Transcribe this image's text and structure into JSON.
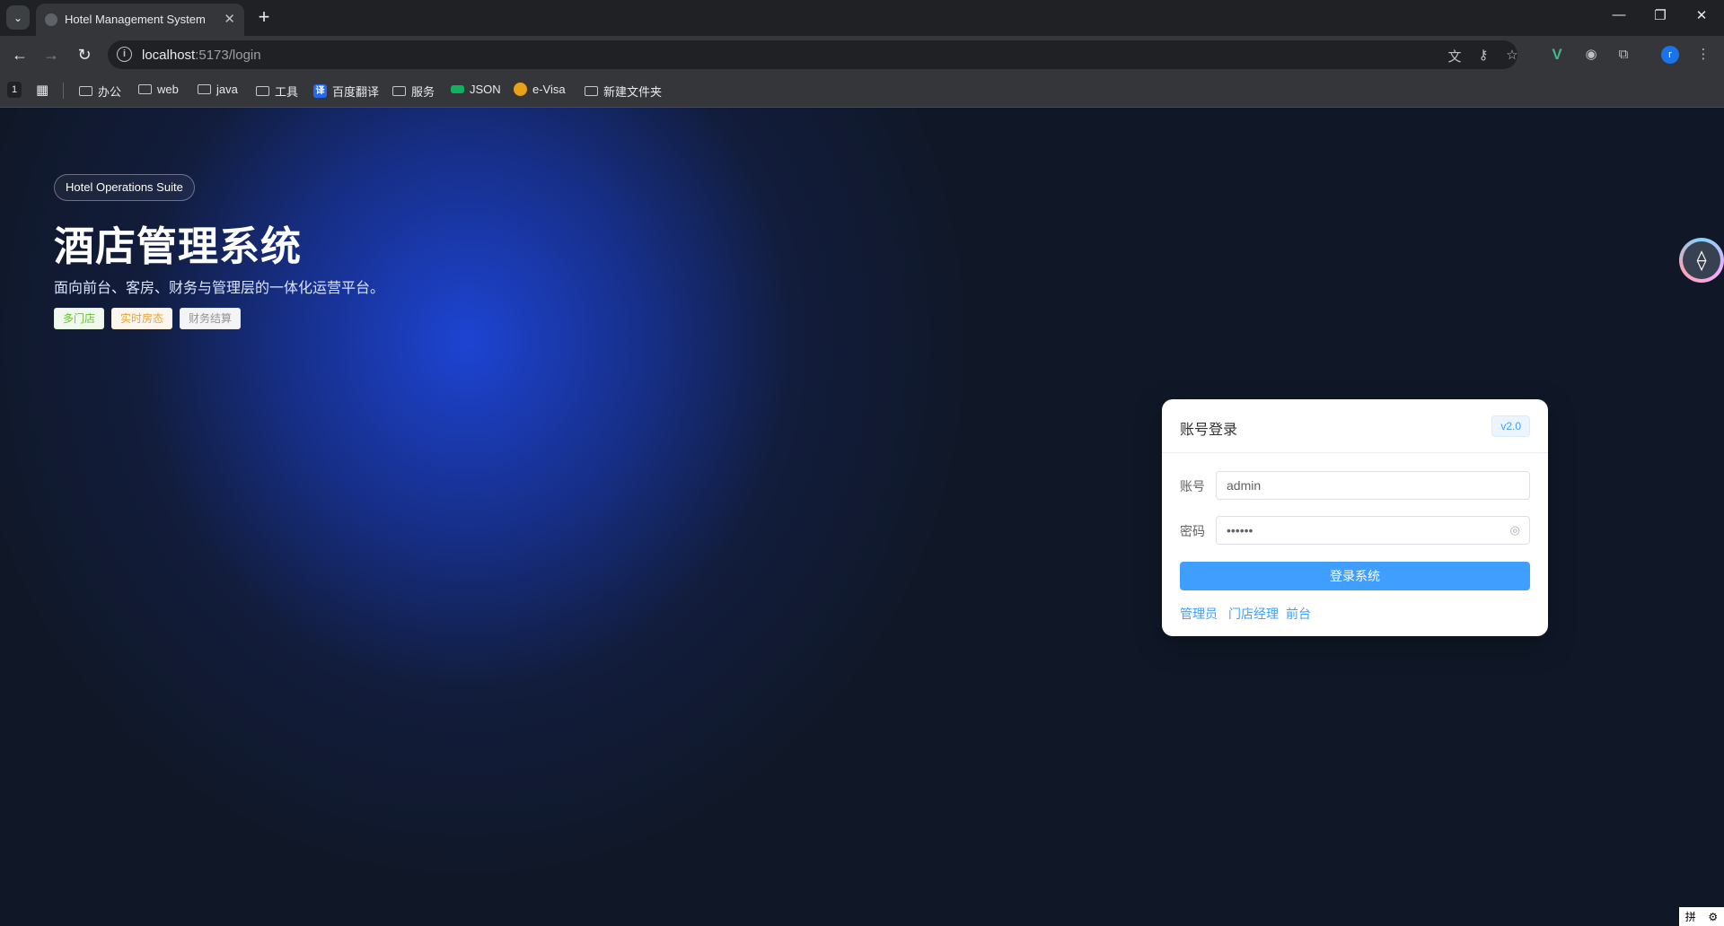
{
  "browser": {
    "tab_title": "Hotel Management System",
    "url_host": "localhost",
    "url_path": ":5173/login",
    "profile_initial": "r",
    "bookmark_count": "1",
    "bookmarks": [
      {
        "label": "办公"
      },
      {
        "label": "web"
      },
      {
        "label": "java"
      },
      {
        "label": "工具"
      },
      {
        "label": "百度翻译"
      },
      {
        "label": "服务"
      },
      {
        "label": "JSON"
      },
      {
        "label": "e-Visa"
      },
      {
        "label": "新建文件夹"
      }
    ]
  },
  "hero": {
    "badge": "Hotel Operations Suite",
    "title": "酒店管理系统",
    "subtitle": "面向前台、客房、财务与管理层的一体化运营平台。",
    "tags": [
      "多门店",
      "实时房态",
      "财务结算"
    ]
  },
  "login": {
    "title": "账号登录",
    "version": "v2.0",
    "account_label": "账号",
    "account_value": "admin",
    "password_label": "密码",
    "password_value": "••••••",
    "submit_label": "登录系统",
    "quick_roles": [
      "管理员",
      "门店经理",
      "前台"
    ]
  },
  "ime": {
    "label": "拼"
  },
  "colors": {
    "primary": "#409eff",
    "hero_glow": "#1e46dc",
    "page_bg": "#101828"
  }
}
